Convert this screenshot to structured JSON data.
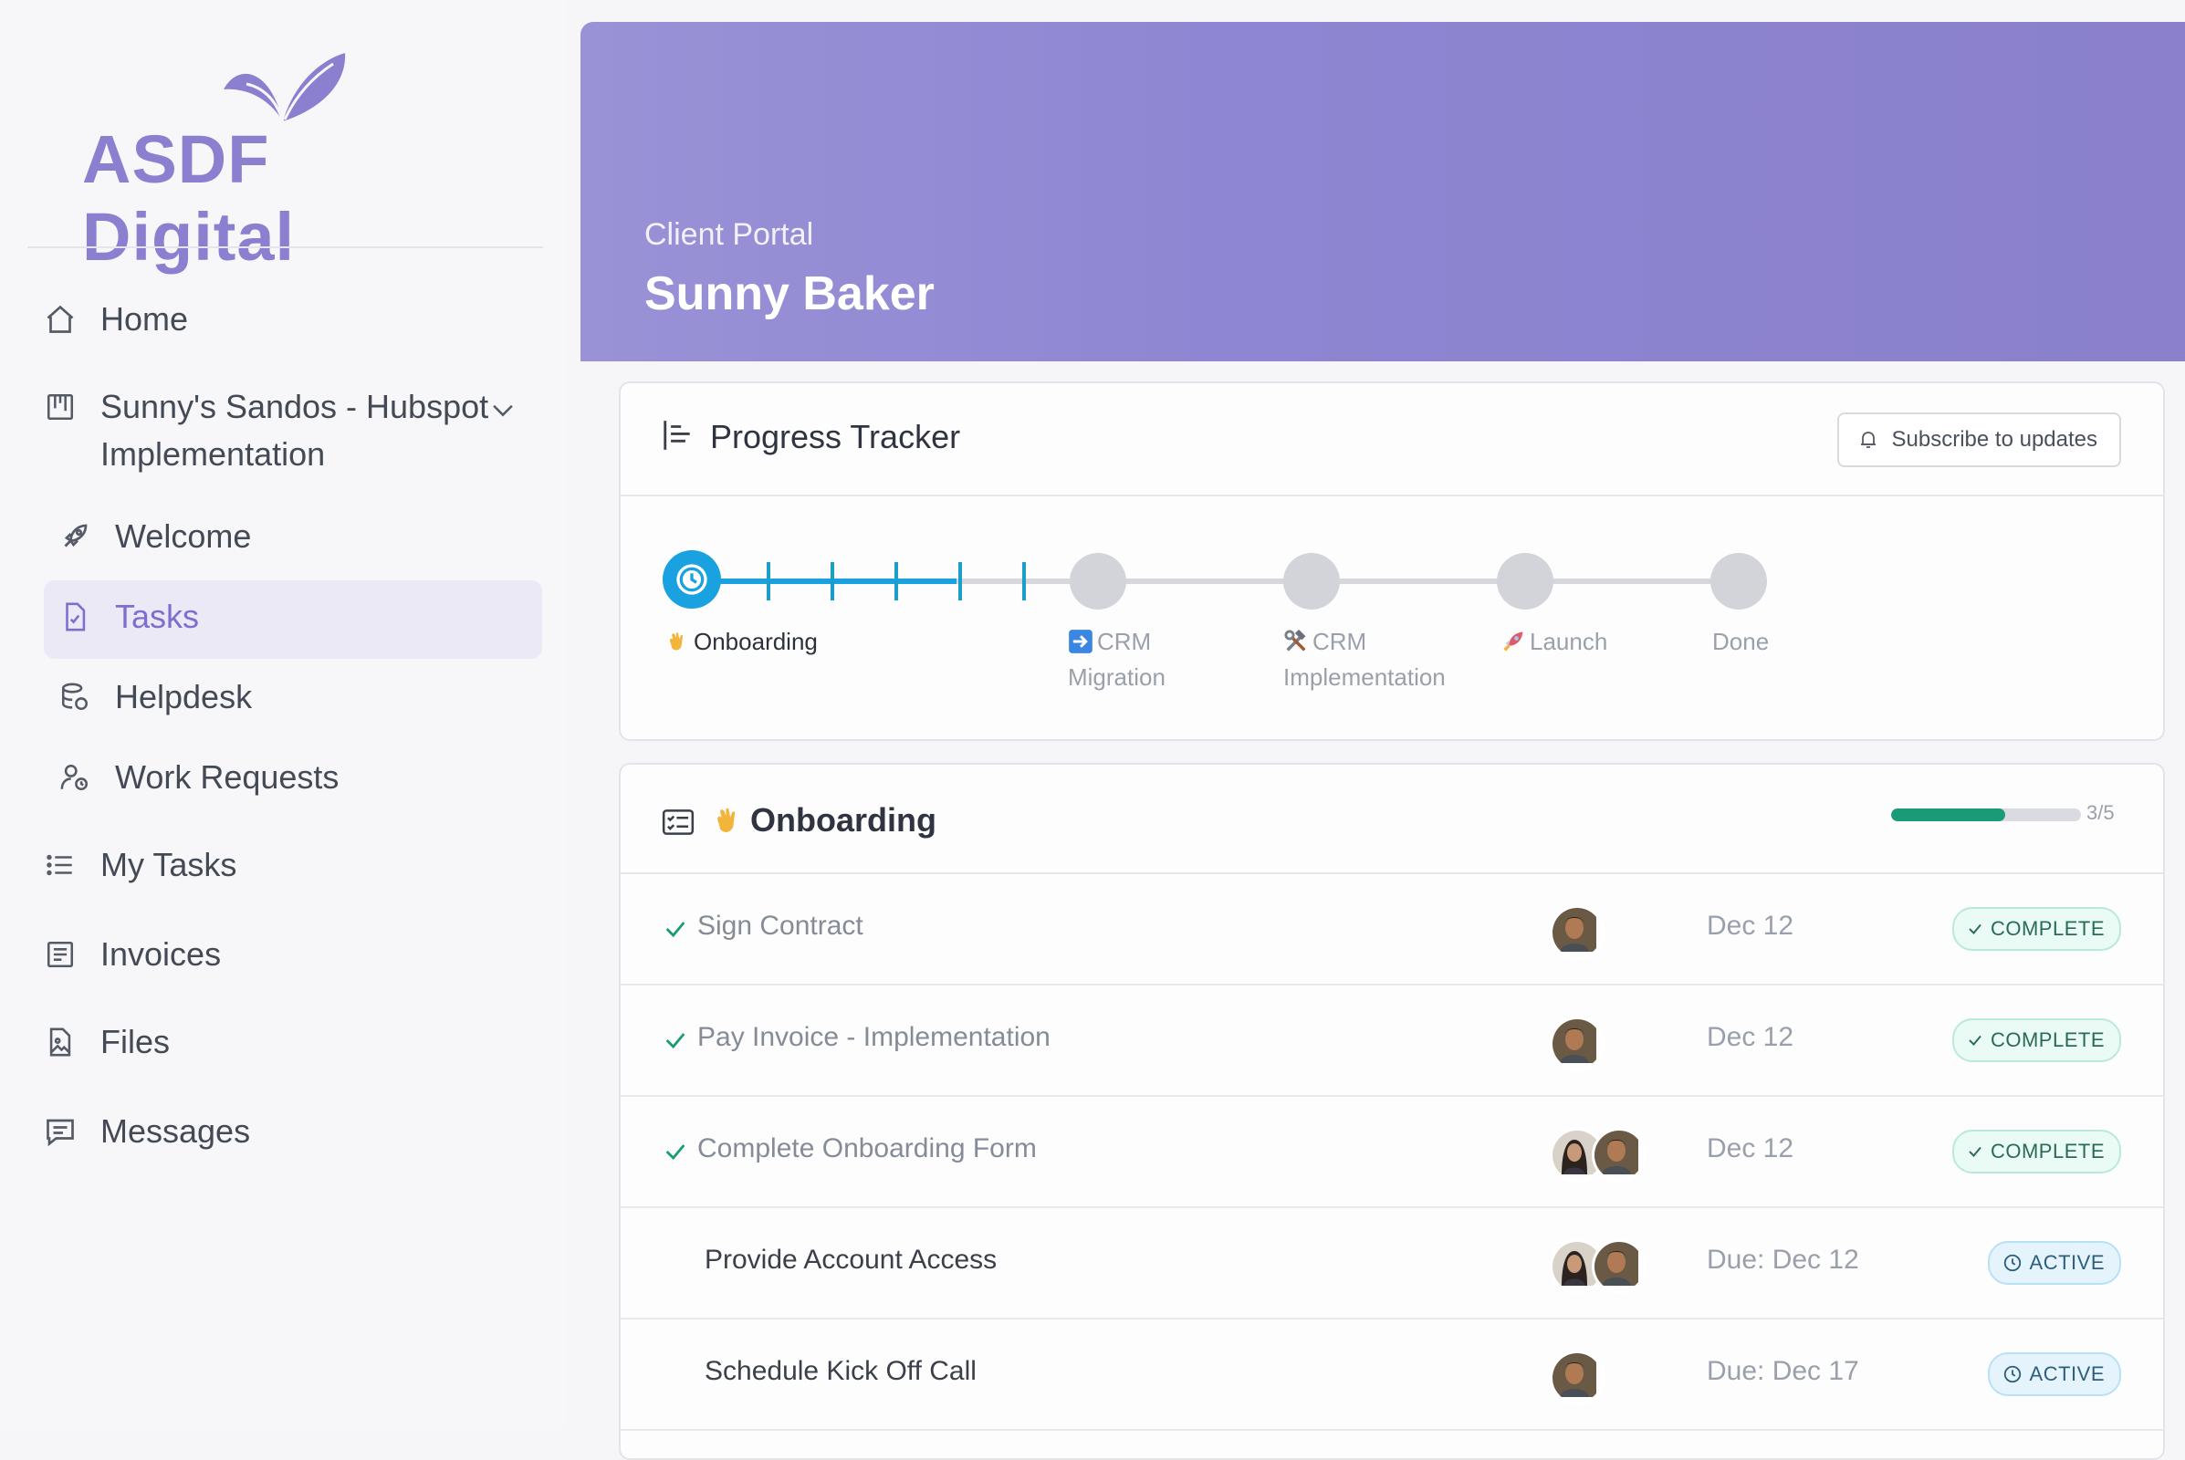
{
  "brand": {
    "name": "ASDF Digital",
    "color": "#8b7fd0"
  },
  "sidebar": {
    "items": [
      {
        "label": "Home",
        "icon": "home-icon"
      },
      {
        "label": "Sunny's Sandos - Hubspot",
        "label2": "Implementation",
        "icon": "project-board-icon",
        "expanded": true
      },
      {
        "label": "Welcome",
        "icon": "rocket-icon"
      },
      {
        "label": "Tasks",
        "icon": "task-file-icon",
        "active": true
      },
      {
        "label": "Helpdesk",
        "icon": "helpdesk-icon"
      },
      {
        "label": "Work Requests",
        "icon": "work-request-icon"
      },
      {
        "label": "My Tasks",
        "icon": "list-icon"
      },
      {
        "label": "Invoices",
        "icon": "invoice-icon"
      },
      {
        "label": "Files",
        "icon": "file-image-icon"
      },
      {
        "label": "Messages",
        "icon": "message-icon"
      }
    ]
  },
  "header": {
    "subtitle": "Client Portal",
    "title": "Sunny Baker"
  },
  "tracker": {
    "title": "Progress Tracker",
    "subscribe_label": "Subscribe to updates",
    "stages": [
      {
        "label": "Onboarding",
        "emoji": "waving-hand",
        "state": "current"
      },
      {
        "label": "CRM",
        "label2": "Migration",
        "emoji": "arrow-right-box",
        "state": "pending"
      },
      {
        "label": "CRM",
        "label2": "Implementation",
        "emoji": "hammer-wrench",
        "state": "pending"
      },
      {
        "label": "Launch",
        "emoji": "rocket",
        "state": "pending"
      },
      {
        "label": "Done",
        "state": "pending"
      }
    ],
    "accent": "#1aa2e0"
  },
  "onboarding": {
    "title": "Onboarding",
    "progress_text": "3/5",
    "progress_fraction": 0.6,
    "progress_color": "#1a9b78",
    "tasks": [
      {
        "name": "Sign Contract",
        "date": "Dec 12",
        "status": "COMPLETE",
        "done": true,
        "avatars": 1
      },
      {
        "name": "Pay Invoice - Implementation",
        "date": "Dec 12",
        "status": "COMPLETE",
        "done": true,
        "avatars": 1
      },
      {
        "name": "Complete Onboarding Form",
        "date": "Dec 12",
        "status": "COMPLETE",
        "done": true,
        "avatars": 2
      },
      {
        "name": "Provide Account Access",
        "date": "Due: Dec 12",
        "status": "ACTIVE",
        "done": false,
        "avatars": 2
      },
      {
        "name": "Schedule Kick Off Call",
        "date": "Due: Dec 17",
        "status": "ACTIVE",
        "done": false,
        "avatars": 1
      }
    ]
  }
}
